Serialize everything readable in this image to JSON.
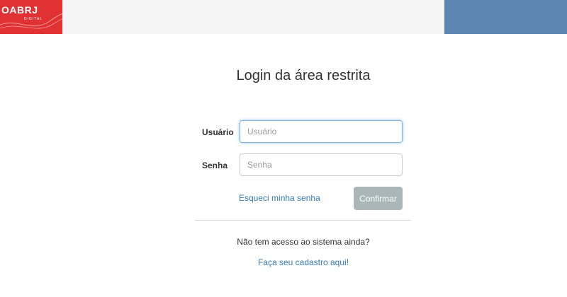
{
  "header": {
    "logo_text": "OABRJ",
    "logo_subtext": "DIGITAL",
    "logo_color": "#e03133",
    "accent_color": "#5b86b3"
  },
  "login": {
    "title": "Login da área restrita",
    "username_label": "Usuário",
    "username_placeholder": "Usuário",
    "password_label": "Senha",
    "password_placeholder": "Senha",
    "forgot_password": "Esqueci minha senha",
    "confirm_label": "Confirmar"
  },
  "footer": {
    "no_access_text": "Não tem acesso ao sistema ainda?",
    "register_link": "Faça seu cadastro aqui!"
  }
}
